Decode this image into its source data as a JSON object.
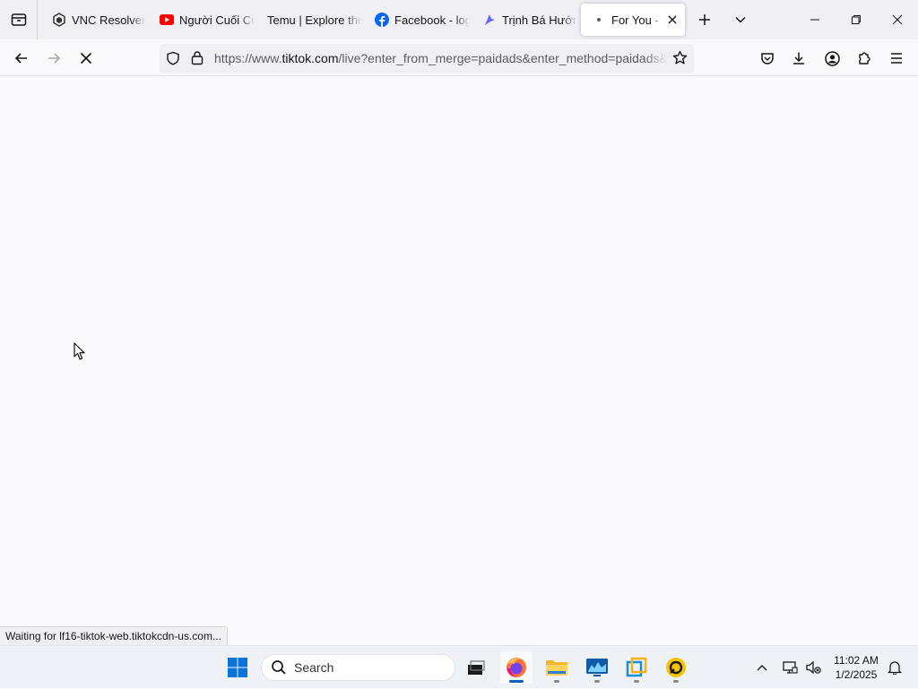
{
  "browser": {
    "tabs": [
      {
        "title": "VNC Resolver",
        "icon": "vnc-icon",
        "active": false
      },
      {
        "title": "Người Cuối Cùng",
        "icon": "youtube-icon",
        "active": false
      },
      {
        "title": "Temu | Explore the",
        "icon": "temu-icon",
        "active": false
      },
      {
        "title": "Facebook - log in",
        "icon": "facebook-icon",
        "active": false
      },
      {
        "title": "Trịnh Bá Hướng",
        "icon": "ai-star-icon",
        "active": false
      },
      {
        "title": "For You - TikTok",
        "icon": "loading-dot-icon",
        "active": true
      }
    ],
    "url": {
      "prefix": "https://www.",
      "domain": "tiktok.com",
      "path": "/live?enter_from_merge=paidads&enter_method=paidads&enter"
    },
    "status": "Waiting for lf16-tiktok-web.tiktokcdn-us.com..."
  },
  "taskbar": {
    "search_label": "Search",
    "time": "11:02 AM",
    "date": "1/2/2025"
  },
  "colors": {
    "accent": "#005fb8",
    "youtube": "#ff0000",
    "facebook": "#0866ff"
  }
}
